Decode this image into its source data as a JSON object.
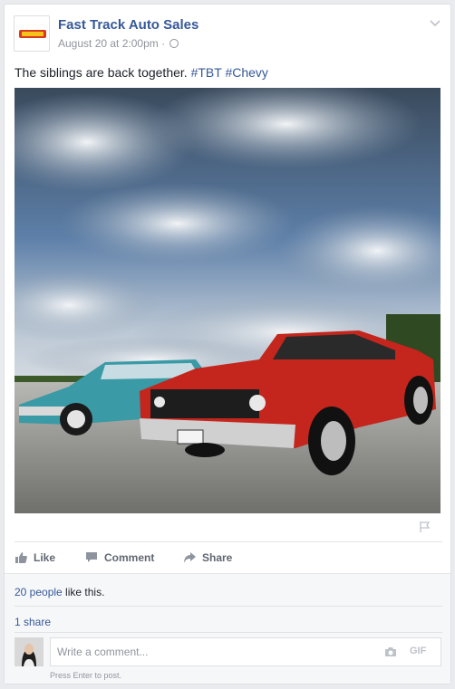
{
  "post": {
    "page_name": "Fast Track Auto Sales",
    "timestamp": "August 20 at 2:00pm",
    "separator": "·",
    "privacy_icon": "globe-icon",
    "menu_icon": "chevron-down-icon",
    "text": "The siblings are back together.",
    "hashtags": [
      "#TBT",
      "#Chevy"
    ],
    "photo_description": "Photo of a red Chevelle SS and a teal classic Chevy under a cloudy sky"
  },
  "actions": {
    "like": "Like",
    "comment": "Comment",
    "share": "Share"
  },
  "social": {
    "likes_link": "20 people",
    "likes_suffix": " like this.",
    "shares": "1 share"
  },
  "composer": {
    "placeholder": "Write a comment...",
    "gif_label": "GIF",
    "hint": "Press Enter to post."
  },
  "colors": {
    "link": "#365899",
    "meta": "#90949c",
    "action_text": "#616770"
  }
}
